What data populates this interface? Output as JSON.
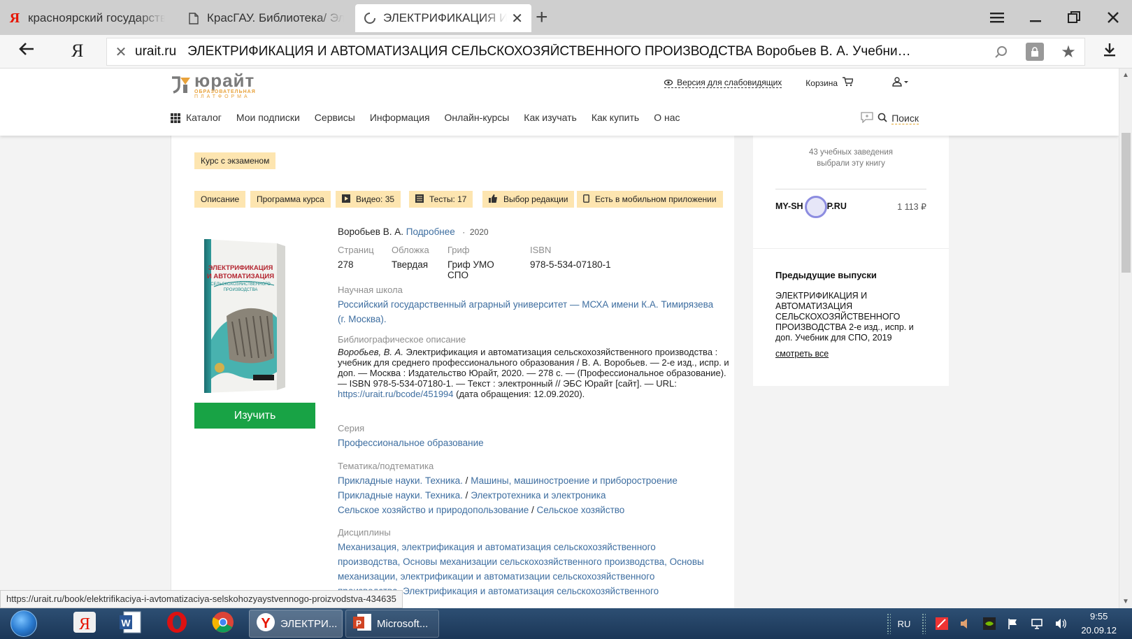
{
  "browser": {
    "tabs": [
      {
        "label": "красноярский государственный",
        "icon": "yandex-icon",
        "active": false
      },
      {
        "label": "КрасГАУ. Библиотека/ Электронные",
        "icon": "document-icon",
        "active": false
      },
      {
        "label": "ЭЛЕКТРИФИКАЦИЯ И АВТОМАТИЗАЦИЯ",
        "icon": "loading-icon",
        "active": true
      }
    ],
    "close_tab": "✕",
    "new_tab": "+",
    "address": {
      "host": "urait.ru",
      "title": "ЭЛЕКТРИФИКАЦИЯ И АВТОМАТИЗАЦИЯ СЕЛЬСКОХОЗЯЙСТВЕННОГО ПРОИЗВОДСТВА Воробьев В. А. Учебник – Об..."
    }
  },
  "site": {
    "logo": {
      "name": "юрайт",
      "sub1": "ОБРАЗОВАТЕЛЬНАЯ",
      "sub2": "ПЛАТФОРМА"
    },
    "vision_link": "Версия для слабовидящих",
    "cart": "Корзина",
    "menu": [
      "Каталог",
      "Мои подписки",
      "Сервисы",
      "Информация",
      "Онлайн-курсы",
      "Как изучать",
      "Как купить",
      "О нас"
    ],
    "search": "Поиск"
  },
  "book": {
    "course_badge": "Курс с экзаменом",
    "tags": [
      {
        "label": "Описание",
        "icon": ""
      },
      {
        "label": "Программа курса",
        "icon": ""
      },
      {
        "label": "Видео: 35",
        "icon": "video-icon"
      },
      {
        "label": "Тесты: 17",
        "icon": "list-icon"
      },
      {
        "label": "Выбор редакции",
        "icon": "thumbs-up-icon"
      },
      {
        "label": "Есть в мобильном приложении",
        "icon": "phone-icon"
      }
    ],
    "study_button": "Изучить",
    "author": "Воробьев В. А.",
    "more_link": "Подробнее",
    "year": "2020",
    "specs": [
      {
        "label": "Страниц",
        "value": "278"
      },
      {
        "label": "Обложка",
        "value": "Твердая"
      },
      {
        "label": "Гриф",
        "value": "Гриф УМО СПО"
      },
      {
        "label": "ISBN",
        "value": "978-5-534-07180-1"
      }
    ],
    "school_label": "Научная школа",
    "school": "Российский государственный аграрный университет — МСХА имени К.А. Тимирязева (г. Москва).",
    "biblio_label": "Библиографическое описание",
    "biblio_author": "Воробьев, В. А.",
    "biblio_text": " Электрификация и автоматизация сельскохозяйственного производства : учебник для среднего профессионального образования / В. А. Воробьев. — 2-е изд., испр. и доп. — Москва : Издательство Юрайт, 2020. — 278 с. — (Профессиональное образование). — ISBN 978-5-534-07180-1. — Текст : электронный // ЭБС Юрайт [сайт]. — URL: ",
    "biblio_url": "https://urait.ru/bcode/451994",
    "biblio_tail": " (дата обращения: 12.09.2020).",
    "series_label": "Серия",
    "series": "Профессиональное образование",
    "topics_label": "Тематика/подтематика",
    "topics": [
      {
        "a": "Прикладные науки. Техника.",
        "b": "Машины, машиностроение и приборостроение"
      },
      {
        "a": "Прикладные науки. Техника.",
        "b": "Электротехника и электроника"
      },
      {
        "a": "Сельское хозяйство и природопользование",
        "b": "Сельское хозяйство"
      }
    ],
    "disciplines_label": "Дисциплины",
    "disciplines": "Механизация, электрификация и автоматизация сельскохозяйственного производства, Основы механизации сельскохозяйственного производства, Основы механизации, электрификации и автоматизации сельскохозяйственного производства, Электрификация и автоматизация сельскохозяйственного"
  },
  "sidebar": {
    "chosen_line1": "43 учебных заведения",
    "chosen_line2": "выбрали эту книгу",
    "shop_left": "MY-SH",
    "shop_right": "P.RU",
    "price": "1 113 ₽",
    "prev_title": "Предыдущие выпуски",
    "prev_text": "ЭЛЕКТРИФИКАЦИЯ И АВТОМАТИЗАЦИЯ СЕЛЬСКОХОЗЯЙСТВЕННОГО ПРОИЗВОДСТВА 2-е изд., испр. и доп. Учебник для СПО, 2019",
    "see_all": "смотреть все"
  },
  "status_url": "https://urait.ru/book/elektrifikaciya-i-avtomatizaciya-selskohozyaystvennogo-proizvodstva-434635",
  "taskbar": {
    "apps": [
      "yandex-icon",
      "word-icon",
      "opera-icon",
      "chrome-icon"
    ],
    "windows": [
      {
        "label": "ЭЛЕКТРИ...",
        "icon": "yandex-browser-icon",
        "active": true
      },
      {
        "label": "Microsoft...",
        "icon": "powerpoint-icon",
        "active": false
      }
    ],
    "lang": "RU",
    "time": "9:55",
    "date": "20.09.12"
  }
}
